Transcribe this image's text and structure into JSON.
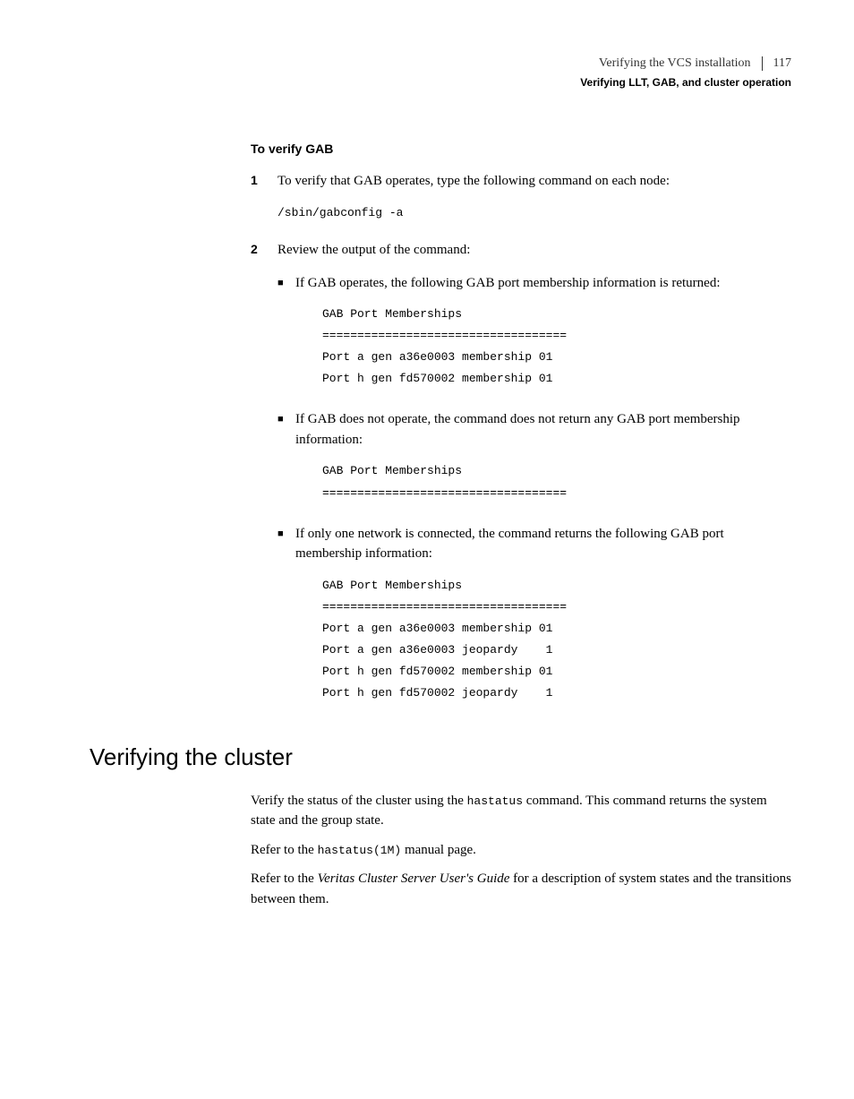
{
  "header": {
    "chapter_title": "Verifying the VCS installation",
    "section_title": "Verifying LLT, GAB, and cluster operation",
    "page_number": "117"
  },
  "sub_heading": "To verify GAB",
  "step1": {
    "num": "1",
    "text": "To verify that GAB operates, type the following command on each node:",
    "code": "/sbin/gabconfig -a"
  },
  "step2": {
    "num": "2",
    "text": "Review the output of the command:",
    "bullet1": {
      "text": "If GAB operates, the following GAB port membership information is returned:",
      "code": "GAB Port Memberships\n===================================\nPort a gen a36e0003 membership 01\nPort h gen fd570002 membership 01"
    },
    "bullet2": {
      "text": "If GAB does not operate, the command does not return any GAB port membership information:",
      "code": "GAB Port Memberships\n==================================="
    },
    "bullet3": {
      "text": "If only one network is connected, the command returns the following GAB port membership information:",
      "code": "GAB Port Memberships\n===================================\nPort a gen a36e0003 membership 01\nPort a gen a36e0003 jeopardy    1\nPort h gen fd570002 membership 01\nPort h gen fd570002 jeopardy    1"
    }
  },
  "section": {
    "heading": "Verifying the cluster",
    "para1_pre": "Verify the status of the cluster using the ",
    "para1_code": "hastatus",
    "para1_post": " command. This command returns the system state and the group state.",
    "para2_pre": "Refer to the ",
    "para2_code": "hastatus(1M)",
    "para2_post": " manual page.",
    "para3_pre": "Refer to the ",
    "para3_em": "Veritas Cluster Server User's Guide",
    "para3_post": " for a description of system states and the transitions between them."
  }
}
